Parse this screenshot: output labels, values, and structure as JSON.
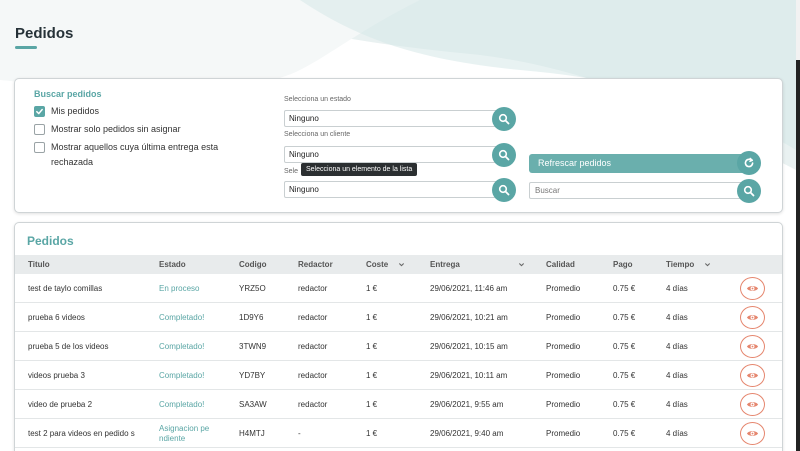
{
  "page": {
    "title": "Pedidos"
  },
  "filters": {
    "heading": "Buscar pedidos",
    "checkboxes": [
      {
        "label": "Mis pedidos",
        "checked": true
      },
      {
        "label": "Mostrar solo pedidos sin asignar",
        "checked": false
      },
      {
        "label": "Mostrar aquellos cuya última entrega esta rechazada",
        "checked": false
      }
    ],
    "estado": {
      "label": "Selecciona un estado",
      "value": "Ninguno"
    },
    "cliente": {
      "label": "Selecciona un cliente",
      "value": "Ninguno"
    },
    "tercero": {
      "label_visible": "Sele",
      "value": "Ninguno"
    },
    "tooltip": "Selecciona un elemento de la lista",
    "refresh_label": "Refrescar pedidos",
    "search_placeholder": "Buscar"
  },
  "orders": {
    "title": "Pedidos",
    "columns": [
      "Titulo",
      "Estado",
      "Codigo",
      "Redactor",
      "Coste",
      "Entrega",
      "Calidad",
      "Pago",
      "Tiempo"
    ],
    "rows": [
      {
        "titulo": "test de taylo comillas",
        "estado": "En proceso",
        "codigo": "YRZ5O",
        "redactor": "redactor",
        "coste": "1 €",
        "entrega": "29/06/2021, 11:46 am",
        "calidad": "Promedio",
        "pago": "0.75 €",
        "tiempo": "4 días"
      },
      {
        "titulo": "prueba 6 videos",
        "estado": "Completado!",
        "codigo": "1D9Y6",
        "redactor": "redactor",
        "coste": "1 €",
        "entrega": "29/06/2021, 10:21 am",
        "calidad": "Promedio",
        "pago": "0.75 €",
        "tiempo": "4 días"
      },
      {
        "titulo": "prueba 5 de los videos",
        "estado": "Completado!",
        "codigo": "3TWN9",
        "redactor": "redactor",
        "coste": "1 €",
        "entrega": "29/06/2021, 10:15 am",
        "calidad": "Promedio",
        "pago": "0.75 €",
        "tiempo": "4 días"
      },
      {
        "titulo": "videos prueba 3",
        "estado": "Completado!",
        "codigo": "YD7BY",
        "redactor": "redactor",
        "coste": "1 €",
        "entrega": "29/06/2021, 10:11 am",
        "calidad": "Promedio",
        "pago": "0.75 €",
        "tiempo": "4 días"
      },
      {
        "titulo": "video de prueba 2",
        "estado": "Completado!",
        "codigo": "SA3AW",
        "redactor": "redactor",
        "coste": "1 €",
        "entrega": "29/06/2021, 9:55 am",
        "calidad": "Promedio",
        "pago": "0.75 €",
        "tiempo": "4 días"
      },
      {
        "titulo": "test 2 para videos en pedido s",
        "estado": "Asignacion pe ndiente",
        "codigo": "H4MTJ",
        "redactor": "-",
        "coste": "1 €",
        "entrega": "29/06/2021, 9:40 am",
        "calidad": "Promedio",
        "pago": "0.75 €",
        "tiempo": "4 días"
      }
    ]
  },
  "colors": {
    "accent": "#5aa6a5",
    "eye": "#e5866e"
  },
  "icons": {
    "search": "search-icon",
    "refresh": "refresh-icon",
    "view": "eye-icon",
    "sort": "chevron-down-icon",
    "check": "check-icon"
  }
}
